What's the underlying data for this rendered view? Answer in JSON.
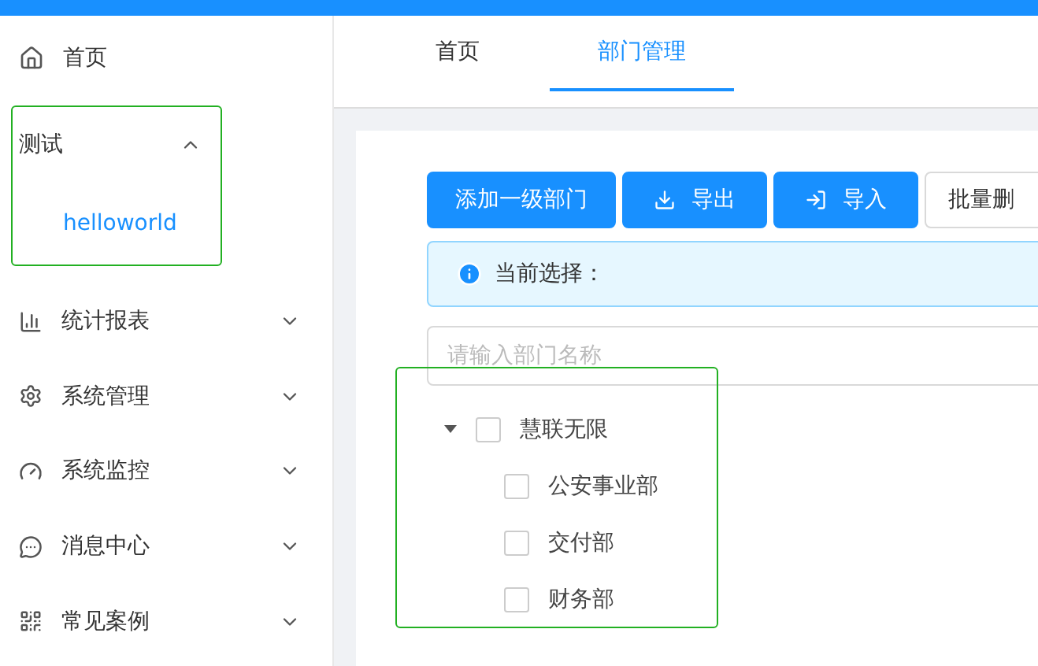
{
  "sidebar": {
    "items": [
      {
        "label": "首页",
        "kind": "link"
      },
      {
        "label": "测试",
        "kind": "group",
        "expanded": true,
        "children": [
          {
            "label": "helloworld",
            "selected": true
          }
        ]
      },
      {
        "label": "统计报表",
        "kind": "group",
        "expanded": false
      },
      {
        "label": "系统管理",
        "kind": "group",
        "expanded": false
      },
      {
        "label": "系统监控",
        "kind": "group",
        "expanded": false
      },
      {
        "label": "消息中心",
        "kind": "group",
        "expanded": false
      },
      {
        "label": "常见案例",
        "kind": "group",
        "expanded": false
      }
    ]
  },
  "tabs": [
    {
      "label": "首页",
      "selected": false
    },
    {
      "label": "部门管理",
      "selected": true
    }
  ],
  "toolbar": {
    "buttons": [
      {
        "label": "添加一级部门",
        "kind": "primary"
      },
      {
        "label": "导出",
        "kind": "primary"
      },
      {
        "label": "导入",
        "kind": "primary"
      },
      {
        "label": "批量删",
        "kind": "default"
      }
    ]
  },
  "alert": {
    "text": "当前选择："
  },
  "search": {
    "placeholder": "请输入部门名称"
  },
  "tree": [
    {
      "label": "慧联无限",
      "expanded": true,
      "checked": false,
      "children": [
        {
          "label": "公安事业部",
          "checked": false
        },
        {
          "label": "交付部",
          "checked": false
        },
        {
          "label": "财务部",
          "checked": false
        }
      ]
    }
  ]
}
